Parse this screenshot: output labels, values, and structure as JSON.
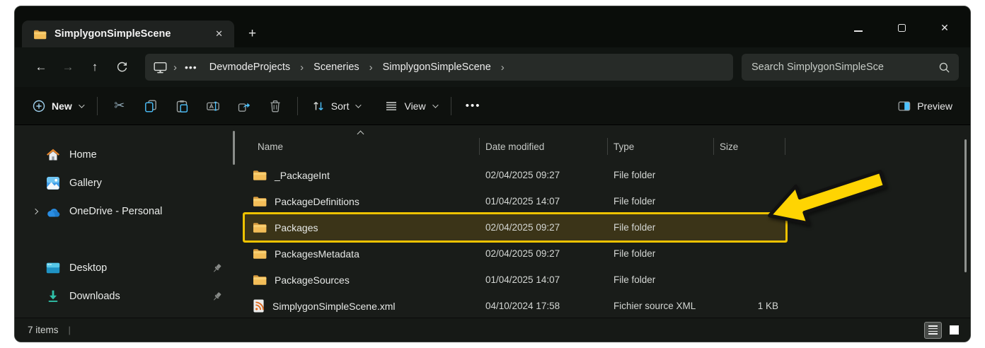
{
  "tab": {
    "title": "SimplygonSimpleScene",
    "close_glyph": "✕",
    "new_tab_glyph": "+"
  },
  "window_controls": {
    "minimize": "minimize",
    "maximize": "maximize",
    "close_glyph": "✕"
  },
  "nav": {
    "back_glyph": "←",
    "forward_glyph": "→",
    "up_glyph": "↑"
  },
  "address": {
    "overflow_glyph": "•••",
    "chevron_glyph": "›",
    "breadcrumbs": [
      "DevmodeProjects",
      "Sceneries",
      "SimplygonSimpleScene"
    ]
  },
  "search": {
    "placeholder": "Search SimplygonSimpleSce"
  },
  "toolbar": {
    "new_label": "New",
    "sort_label": "Sort",
    "view_label": "View",
    "more_glyph": "•••",
    "preview_label": "Preview",
    "cut_glyph": "✂"
  },
  "sidebar": {
    "items": [
      {
        "label": "Home"
      },
      {
        "label": "Gallery"
      },
      {
        "label": "OneDrive - Personal"
      },
      {
        "label": "Desktop"
      },
      {
        "label": "Downloads"
      }
    ]
  },
  "list": {
    "columns": [
      "Name",
      "Date modified",
      "Type",
      "Size"
    ],
    "rows": [
      {
        "name": "_PackageInt",
        "date": "02/04/2025 09:27",
        "type": "File folder",
        "size": ""
      },
      {
        "name": "PackageDefinitions",
        "date": "01/04/2025 14:07",
        "type": "File folder",
        "size": ""
      },
      {
        "name": "Packages",
        "date": "02/04/2025 09:27",
        "type": "File folder",
        "size": ""
      },
      {
        "name": "PackagesMetadata",
        "date": "02/04/2025 09:27",
        "type": "File folder",
        "size": ""
      },
      {
        "name": "PackageSources",
        "date": "01/04/2025 14:07",
        "type": "File folder",
        "size": ""
      },
      {
        "name": "SimplygonSimpleScene.xml",
        "date": "04/10/2024 17:58",
        "type": "Fichier source XML",
        "size": "1 KB"
      }
    ],
    "highlighted_row": "Packages"
  },
  "statusbar": {
    "items_count": "7 items",
    "divider_glyph": "|"
  },
  "colors": {
    "accent": "#4cc2ff",
    "annotation_yellow": "#ffd402",
    "folder_yellow": "#f3bd58",
    "highlight_fill": "#3b3418"
  }
}
